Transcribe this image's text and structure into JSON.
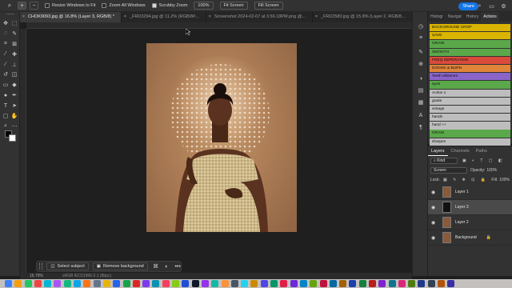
{
  "options_bar": {
    "tool_icon": "zoom-tool-icon",
    "resize_windows_label": "Resize Windows to Fit",
    "zoom_all_label": "Zoom All Windows",
    "scrubby_zoom_label": "Scrubby Zoom",
    "zoom_value": "100%",
    "fit_screen_label": "Fit Screen",
    "fill_screen_label": "Fill Screen",
    "share_label": "Share",
    "checks": {
      "resize_windows": false,
      "zoom_all": false,
      "scrubby_zoom": true
    }
  },
  "tabs": [
    {
      "label": "CHOK9093.jpg @ 16.8% (Layer 3, RGB/8) *",
      "active": true
    },
    {
      "label": "_FRD3294.jpg @ 11.2% (RGB/8#...",
      "active": false
    },
    {
      "label": "Screenshot 2024-02-07 at 3.56.18PM.png @...",
      "active": false
    },
    {
      "label": "_FRD2580.jpg @ 15.8% (Layer 2, RGB/8...",
      "active": false
    }
  ],
  "status_bar": {
    "zoom": "16.79%",
    "profile": "sRGB IEC61966-2.1 (8bpc)"
  },
  "contextual_task_bar": {
    "select_subject_label": "Select subject",
    "remove_background_label": "Remove background",
    "more_label": "•••"
  },
  "top_panel": {
    "tabs": [
      "Histogr",
      "Navigat",
      "History",
      "Actions"
    ],
    "actions": [
      {
        "label": "BACKGROUND CROP",
        "color": "#d9b400"
      },
      {
        "label": "SAVE",
        "color": "#d9b400"
      },
      {
        "label": "GRAIN",
        "color": "#5aa84a"
      },
      {
        "label": "SMOOTH",
        "color": "#5aa84a"
      },
      {
        "label": "FREQ SEPERATION",
        "color": "#d94b3b"
      },
      {
        "label": "DODGE & BURN",
        "color": "#e0843a"
      },
      {
        "label": "Teeth whitenen",
        "color": "#8a64c8"
      },
      {
        "label": "eyes",
        "color": "#5aa84a"
      },
      {
        "label": "Action 1",
        "color": "#bdbdbd"
      },
      {
        "label": "grade",
        "color": "#bdbdbd"
      },
      {
        "label": "vintage",
        "color": "#bdbdbd"
      },
      {
        "label": "hands",
        "color": "#bdbdbd"
      },
      {
        "label": "hand ++",
        "color": "#bdbdbd"
      },
      {
        "label": "GRAIN",
        "color": "#5aa84a"
      },
      {
        "label": "sharpen",
        "color": "#bdbdbd"
      }
    ]
  },
  "layers_panel": {
    "tabs": [
      "Layers",
      "Channels",
      "Paths"
    ],
    "kind_label": "Kind",
    "blend_mode": "Screen",
    "opacity_label": "Opacity:",
    "opacity_value": "100%",
    "lock_label": "Lock:",
    "fill_label": "Fill:",
    "fill_value": "100%",
    "layers": [
      {
        "name": "Layer 1",
        "selected": false,
        "thumb": "#8a5a3a"
      },
      {
        "name": "Layer 3",
        "selected": true,
        "thumb": "#111111"
      },
      {
        "name": "Layer 2",
        "selected": false,
        "thumb": "#8a5a3a"
      },
      {
        "name": "Background",
        "selected": false,
        "thumb": "#8a5a3a",
        "locked": true
      }
    ]
  },
  "dock_colors": [
    "#3b82f6",
    "#f59e0b",
    "#22c55e",
    "#ef4444",
    "#06b6d4",
    "#a855f7",
    "#10b981",
    "#0ea5e9",
    "#f97316",
    "#64748b",
    "#eab308",
    "#2563eb",
    "#16a34a",
    "#dc2626",
    "#7c3aed",
    "#0891b2",
    "#f43f5e",
    "#84cc16",
    "#1d4ed8",
    "#0f172a",
    "#9333ea",
    "#14b8a6",
    "#fb923c",
    "#475569",
    "#22d3ee",
    "#ca8a04",
    "#4f46e5",
    "#059669",
    "#e11d48",
    "#6d28d9",
    "#0284c7",
    "#65a30d",
    "#be123c",
    "#0369a1",
    "#a16207",
    "#1e40af",
    "#15803d",
    "#b91c1c",
    "#7e22ce",
    "#0e7490",
    "#db2777",
    "#4d7c0f",
    "#1e3a8a",
    "#334155",
    "#b45309",
    "#3730a3"
  ]
}
